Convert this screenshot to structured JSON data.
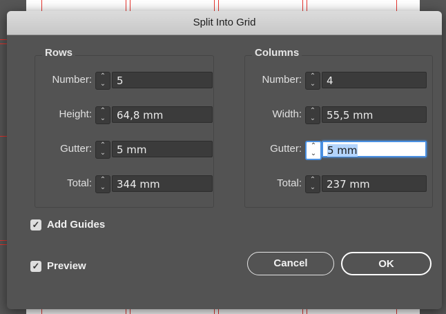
{
  "dialog": {
    "title": "Split Into Grid",
    "rows": {
      "title": "Rows",
      "number": {
        "label": "Number:",
        "value": "5"
      },
      "height": {
        "label": "Height:",
        "value": "64,8 mm"
      },
      "gutter": {
        "label": "Gutter:",
        "value": "5 mm"
      },
      "total": {
        "label": "Total:",
        "value": "344 mm"
      }
    },
    "columns": {
      "title": "Columns",
      "number": {
        "label": "Number:",
        "value": "4"
      },
      "width": {
        "label": "Width:",
        "value": "55,5 mm"
      },
      "gutter": {
        "label": "Gutter:",
        "value": "5 mm"
      },
      "total": {
        "label": "Total:",
        "value": "237 mm"
      }
    },
    "add_guides": {
      "label": "Add Guides",
      "checked": true
    },
    "preview": {
      "label": "Preview",
      "checked": true
    },
    "buttons": {
      "cancel": "Cancel",
      "ok": "OK"
    }
  },
  "icons": {
    "spinner": "up-down-stepper-icon",
    "check": "checkmark-icon"
  },
  "colors": {
    "guide": "#e8342e",
    "focus": "#4a90e2",
    "dialog_bg": "#535353"
  }
}
